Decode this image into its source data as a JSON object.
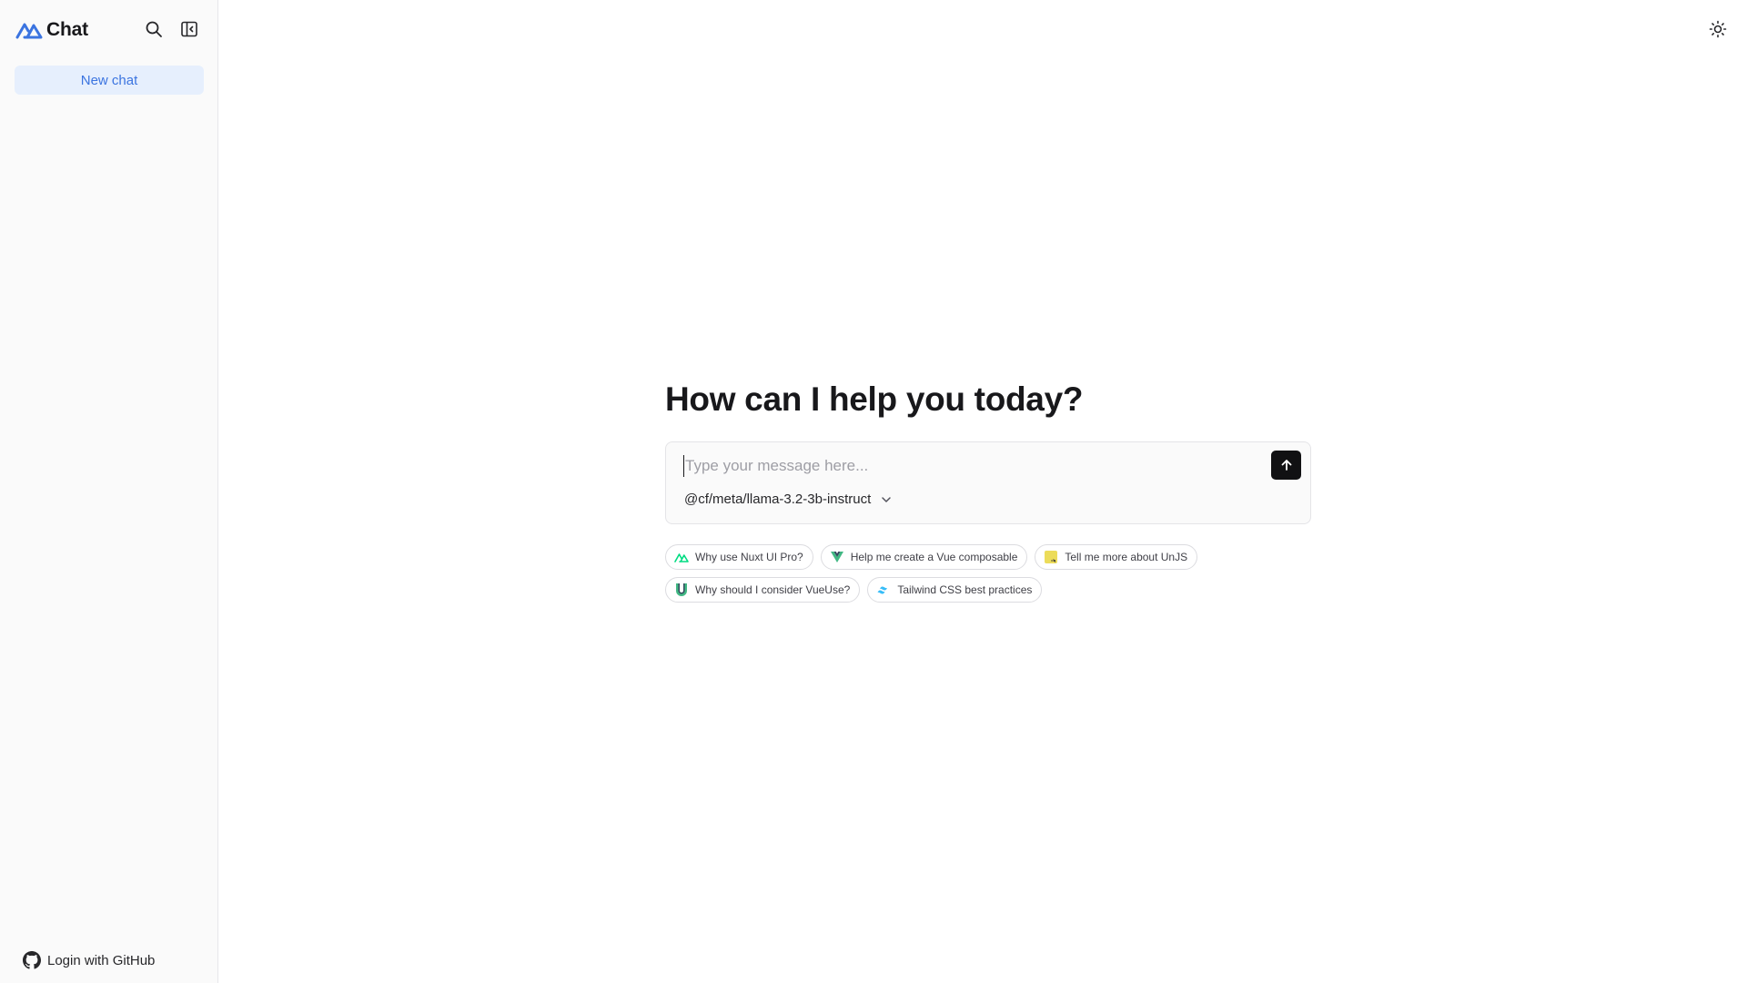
{
  "sidebar": {
    "brand_title": "Chat",
    "new_chat_label": "New chat",
    "login_label": "Login with GitHub"
  },
  "main": {
    "headline": "How can I help you today?",
    "composer": {
      "placeholder": "Type your message here...",
      "value": "",
      "model": "@cf/meta/llama-3.2-3b-instruct"
    },
    "suggestions": [
      {
        "label": "Why use Nuxt UI Pro?",
        "icon": "nuxt-icon"
      },
      {
        "label": "Help me create a Vue composable",
        "icon": "vue-icon"
      },
      {
        "label": "Tell me more about UnJS",
        "icon": "unjs-icon"
      },
      {
        "label": "Why should I consider VueUse?",
        "icon": "vueuse-icon"
      },
      {
        "label": "Tailwind CSS best practices",
        "icon": "tailwind-icon"
      }
    ]
  },
  "icons": {
    "brand": "nuxt-logo-icon",
    "search": "search-icon",
    "collapse": "sidebar-collapse-icon",
    "github": "github-icon",
    "theme": "sun-icon",
    "send": "arrow-up-icon",
    "chevron": "chevron-down-icon"
  },
  "colors": {
    "accent": "#3b74e0",
    "accent_bg": "#e6effd",
    "sidebar_bg": "#fafafa",
    "send_bg": "#111113",
    "nuxt_green": "#00dc82",
    "vue_green": "#41b883",
    "unjs_yellow": "#ecdc5a",
    "tailwind_cyan": "#38bdf8"
  }
}
